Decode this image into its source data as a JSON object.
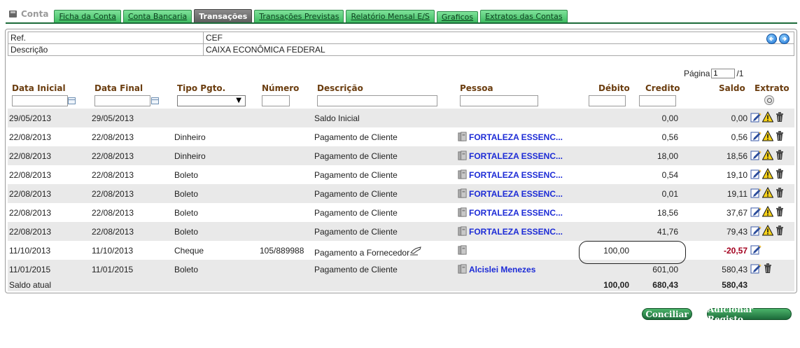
{
  "brand": {
    "label": "Conta"
  },
  "tabs": [
    {
      "label": "Ficha da Conta",
      "active": false
    },
    {
      "label": "Conta Bancaria",
      "active": false
    },
    {
      "label": "Transações",
      "active": true
    },
    {
      "label": "Transações Previstas",
      "active": false
    },
    {
      "label": "Relatório Mensal E/S",
      "active": false
    },
    {
      "label": "Graficos",
      "active": false
    },
    {
      "label": "Extratos das Contas",
      "active": false
    }
  ],
  "info": {
    "ref_label": "Ref.",
    "ref_value": "CEF",
    "desc_label": "Descrição",
    "desc_value": "CAIXA ECONÔMICA FEDERAL"
  },
  "pager": {
    "label": "Página",
    "current": "1",
    "total": "/1"
  },
  "columns": {
    "data_inicial": "Data Inicial",
    "data_final": "Data Final",
    "tipo_pgto": "Tipo Pgto.",
    "numero": "Número",
    "descricao": "Descrição",
    "pessoa": "Pessoa",
    "debito": "Débito",
    "credito": "Credito",
    "saldo": "Saldo",
    "extrato": "Extrato"
  },
  "rows": [
    {
      "di": "29/05/2013",
      "df": "29/05/2013",
      "tp": "",
      "num": "",
      "desc": "Saldo Inicial",
      "pessoa": "",
      "pessoa_icon": false,
      "deb": "",
      "cre": "0,00",
      "sal": "0,00",
      "neg": false,
      "desc_icon": false,
      "actions": [
        "edit",
        "warn",
        "trash"
      ]
    },
    {
      "di": "22/08/2013",
      "df": "22/08/2013",
      "tp": "Dinheiro",
      "num": "",
      "desc": "Pagamento de Cliente",
      "pessoa": "FORTALEZA ESSENC...",
      "pessoa_icon": true,
      "deb": "",
      "cre": "0,56",
      "sal": "0,56",
      "neg": false,
      "desc_icon": false,
      "actions": [
        "edit",
        "warn",
        "trash"
      ]
    },
    {
      "di": "22/08/2013",
      "df": "22/08/2013",
      "tp": "Dinheiro",
      "num": "",
      "desc": "Pagamento de Cliente",
      "pessoa": "FORTALEZA ESSENC...",
      "pessoa_icon": true,
      "deb": "",
      "cre": "18,00",
      "sal": "18,56",
      "neg": false,
      "desc_icon": false,
      "actions": [
        "edit",
        "warn",
        "trash"
      ]
    },
    {
      "di": "22/08/2013",
      "df": "22/08/2013",
      "tp": "Boleto",
      "num": "",
      "desc": "Pagamento de Cliente",
      "pessoa": "FORTALEZA ESSENC...",
      "pessoa_icon": true,
      "deb": "",
      "cre": "0,54",
      "sal": "19,10",
      "neg": false,
      "desc_icon": false,
      "actions": [
        "edit",
        "warn",
        "trash"
      ]
    },
    {
      "di": "22/08/2013",
      "df": "22/08/2013",
      "tp": "Boleto",
      "num": "",
      "desc": "Pagamento de Cliente",
      "pessoa": "FORTALEZA ESSENC...",
      "pessoa_icon": true,
      "deb": "",
      "cre": "0,01",
      "sal": "19,11",
      "neg": false,
      "desc_icon": false,
      "actions": [
        "edit",
        "warn",
        "trash"
      ]
    },
    {
      "di": "22/08/2013",
      "df": "22/08/2013",
      "tp": "Boleto",
      "num": "",
      "desc": "Pagamento de Cliente",
      "pessoa": "FORTALEZA ESSENC...",
      "pessoa_icon": true,
      "deb": "",
      "cre": "18,56",
      "sal": "37,67",
      "neg": false,
      "desc_icon": false,
      "actions": [
        "edit",
        "warn",
        "trash"
      ]
    },
    {
      "di": "22/08/2013",
      "df": "22/08/2013",
      "tp": "Boleto",
      "num": "",
      "desc": "Pagamento de Cliente",
      "pessoa": "FORTALEZA ESSENC...",
      "pessoa_icon": true,
      "deb": "",
      "cre": "41,76",
      "sal": "79,43",
      "neg": false,
      "desc_icon": false,
      "actions": [
        "edit",
        "warn",
        "trash"
      ]
    },
    {
      "di": "11/10/2013",
      "df": "11/10/2013",
      "tp": "Cheque",
      "num": "105/889988",
      "desc": "Pagamento a Fornecedor",
      "pessoa": "",
      "pessoa_icon": true,
      "deb": "100,00",
      "cre": "",
      "sal": "-20,57",
      "neg": true,
      "desc_icon": true,
      "actions": [
        "edit"
      ]
    },
    {
      "di": "11/01/2015",
      "df": "11/01/2015",
      "tp": "Boleto",
      "num": "",
      "desc": "Pagamento de Cliente",
      "pessoa": "Alcislei Menezes",
      "pessoa_icon": true,
      "deb": "",
      "cre": "601,00",
      "sal": "580,43",
      "neg": false,
      "desc_icon": false,
      "actions": [
        "edit",
        "trash"
      ]
    }
  ],
  "totals": {
    "label": "Saldo atual",
    "deb": "100,00",
    "cre": "680,43",
    "sal": "580,43"
  },
  "buttons": {
    "conciliar": "Conciliar",
    "adicionar": "Adicionar Registo"
  },
  "colors": {
    "tab_green": "#3fbd62",
    "link_blue": "#1c2bd6",
    "header_brown": "#6b3d0f",
    "negative_red": "#a3001e"
  }
}
